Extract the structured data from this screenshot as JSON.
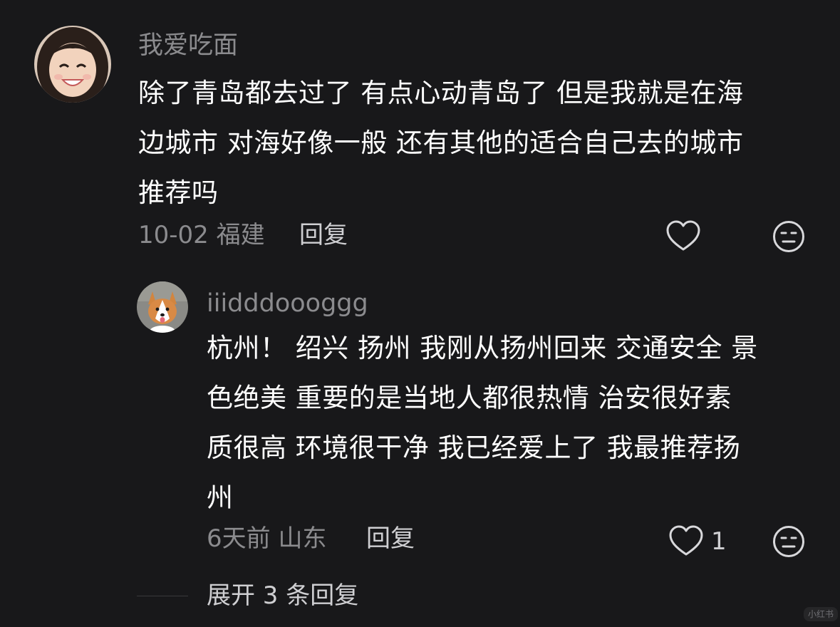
{
  "comment": {
    "username": "我爱吃面",
    "text_lines": [
      "除了青岛都去过了 有点心动青岛了 但是我就是在海",
      "边城市 对海好像一般 还有其他的适合自己去的城市",
      "推荐吗"
    ],
    "date": "10-02",
    "location": "福建",
    "reply_label": "回复",
    "like_icon": "heart-outline-icon",
    "dislike_icon": "meh-face-icon"
  },
  "reply": {
    "username": "iiidddoooggg",
    "text_lines": [
      "杭州！ 绍兴 扬州 我刚从扬州回来 交通安全 景",
      "色绝美 重要的是当地人都很热情 治安很好素",
      "质很高 环境很干净 我已经爱上了 我最推荐扬",
      "州"
    ],
    "date": "6天前",
    "location": "山东",
    "reply_label": "回复",
    "like_count": "1",
    "like_icon": "heart-outline-icon",
    "dislike_icon": "meh-face-icon"
  },
  "expand_label": "展开 3 条回复",
  "watermark": "小红书",
  "colors": {
    "background": "#18181a",
    "text_primary": "#ffffff",
    "text_secondary": "#8b8b8e",
    "action": "#cfcfd2"
  }
}
